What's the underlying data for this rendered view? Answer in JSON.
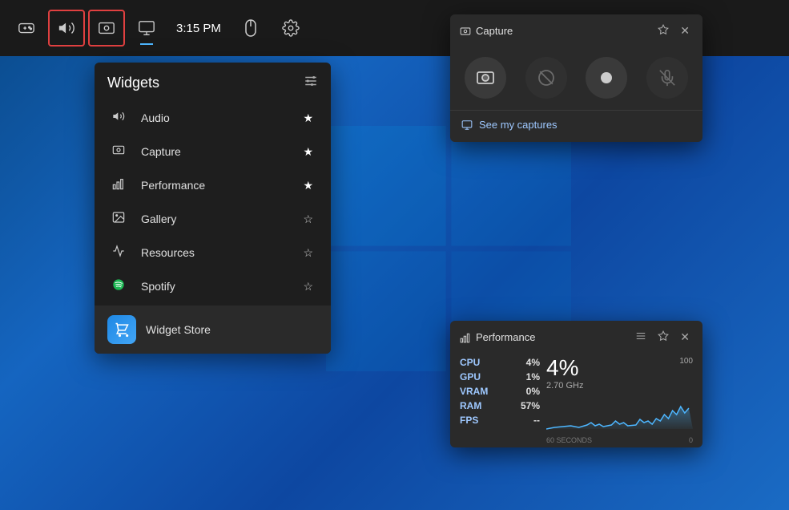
{
  "taskbar": {
    "icons": [
      {
        "name": "controller-icon",
        "symbol": "🎮",
        "outlined": false,
        "active": false
      },
      {
        "name": "audio-icon",
        "symbol": "🔊",
        "outlined": true,
        "active": false
      },
      {
        "name": "capture-icon",
        "symbol": "⏺",
        "outlined": true,
        "active": false
      },
      {
        "name": "display-icon",
        "symbol": "🖥",
        "outlined": false,
        "active": true
      }
    ],
    "time": "3:15 PM",
    "mouse_icon": "🖱",
    "settings_icon": "⚙"
  },
  "widgets_panel": {
    "title": "Widgets",
    "settings_icon": "≡",
    "items": [
      {
        "icon": "🔊",
        "label": "Audio",
        "star": "★",
        "filled": true
      },
      {
        "icon": "⏺",
        "label": "Capture",
        "star": "★",
        "filled": true
      },
      {
        "icon": "📊",
        "label": "Performance",
        "star": "★",
        "filled": true
      },
      {
        "icon": "🖼",
        "label": "Gallery",
        "star": "☆",
        "filled": false
      },
      {
        "icon": "📉",
        "label": "Resources",
        "star": "☆",
        "filled": false
      },
      {
        "icon": "🎵",
        "label": "Spotify",
        "star": "☆",
        "filled": false
      }
    ],
    "store": {
      "icon": "🏪",
      "label": "Widget Store"
    }
  },
  "capture_popup": {
    "icon": "⏺",
    "title": "Capture",
    "pin_icon": "📌",
    "close_icon": "✕",
    "buttons": [
      {
        "name": "screenshot-btn",
        "symbol": "📷",
        "disabled": false
      },
      {
        "name": "record-off-btn",
        "symbol": "⊘",
        "disabled": true
      },
      {
        "name": "record-btn",
        "symbol": "⚫",
        "disabled": false
      },
      {
        "name": "mic-off-btn",
        "symbol": "🎙",
        "disabled": true
      }
    ],
    "see_captures_icon": "🖥",
    "see_captures_label": "See my captures"
  },
  "performance_popup": {
    "icon": "📊",
    "title": "Performance",
    "settings_icon": "≡",
    "pin_icon": "📌",
    "close_icon": "✕",
    "stats": [
      {
        "key": "CPU",
        "value": "4%"
      },
      {
        "key": "GPU",
        "value": "1%"
      },
      {
        "key": "VRAM",
        "value": "0%"
      },
      {
        "key": "RAM",
        "value": "57%"
      },
      {
        "key": "FPS",
        "value": "--"
      }
    ],
    "big_percent": "4%",
    "frequency": "2.70 GHz",
    "chart_top": "100",
    "chart_bottom_left": "60 SECONDS",
    "chart_bottom_right": "0"
  }
}
